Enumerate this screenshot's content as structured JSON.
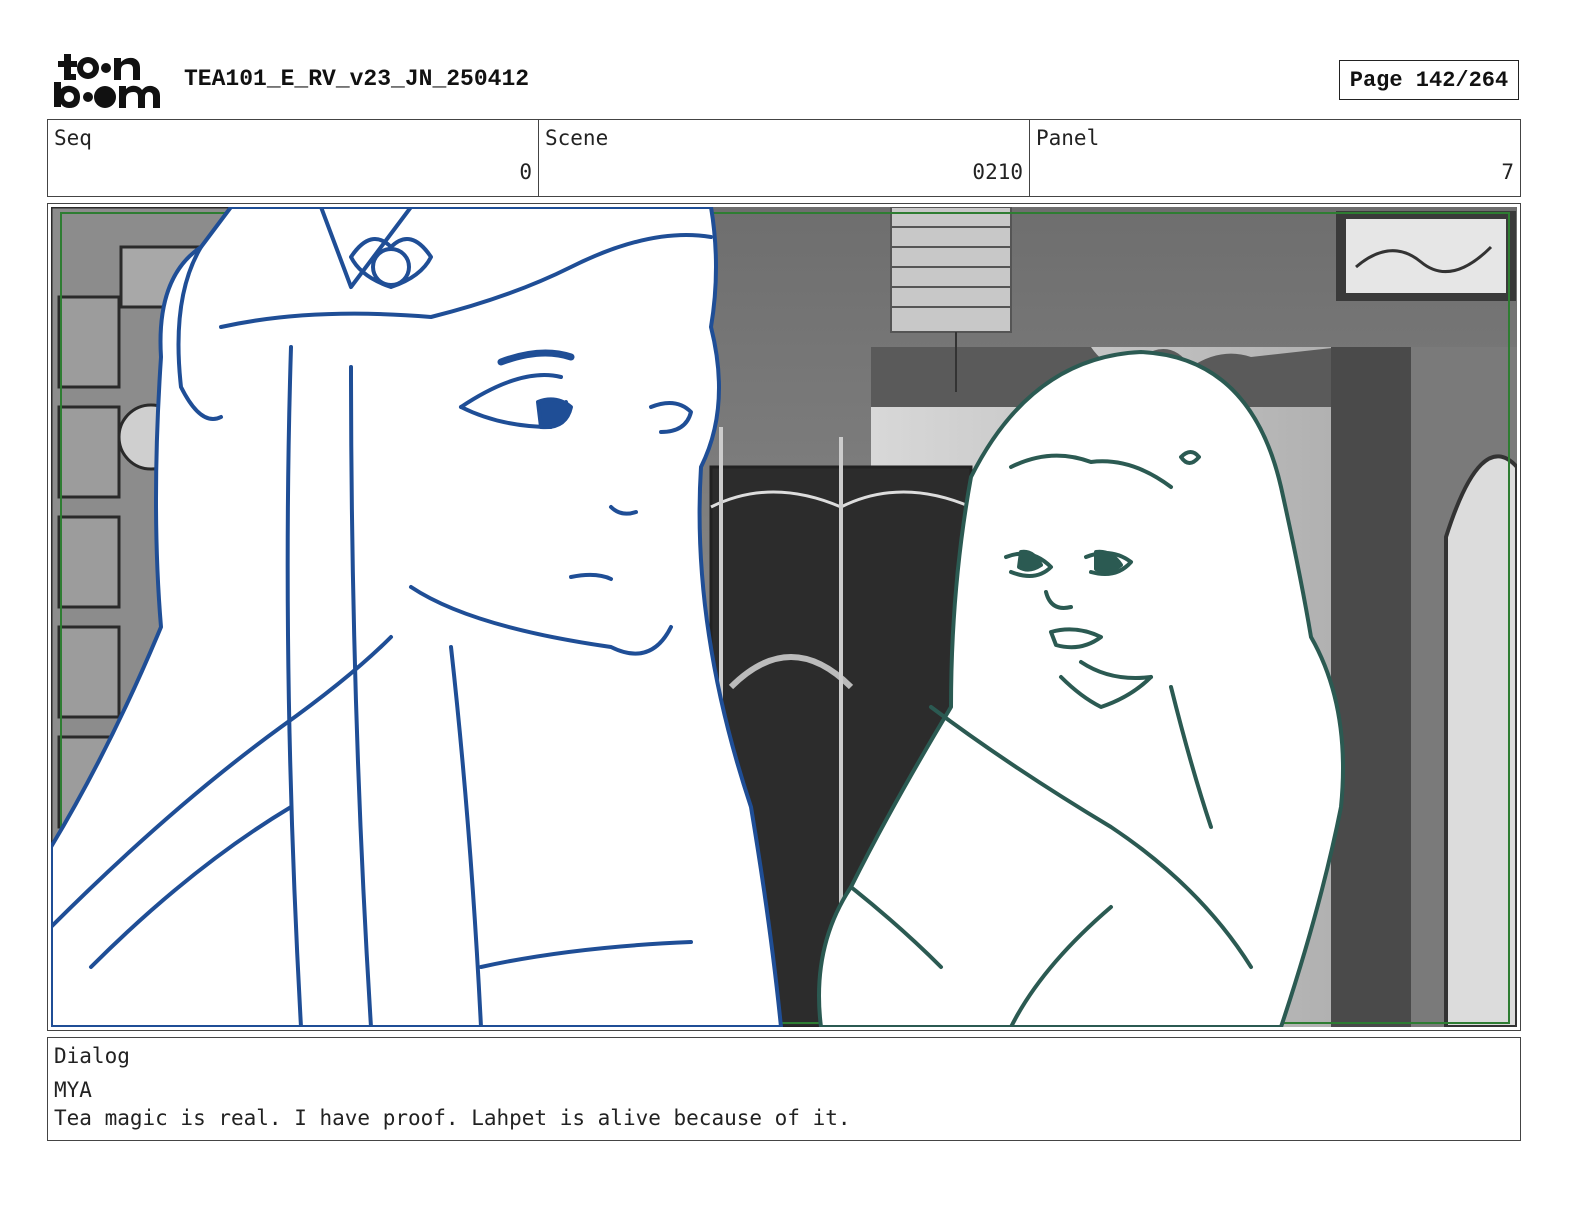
{
  "header": {
    "logo_text": "toon boom",
    "doc_title": "TEA101_E_RV_v23_JN_250412",
    "page_label": "Page 142/264"
  },
  "info": {
    "seq_label": "Seq",
    "seq_value": "0",
    "scene_label": "Scene",
    "scene_value": "0210",
    "panel_label": "Panel",
    "panel_value": "7"
  },
  "dialog": {
    "label": "Dialog",
    "speaker": "MYA",
    "line": "Tea magic is real. I have proof. Lahpet is alive because of it."
  },
  "colors": {
    "left_character_line": "#1f4e96",
    "right_character_line": "#2b5a52",
    "safe_frame": "#2e7d32",
    "background_gray": "#8a8a8a"
  },
  "icons": [
    "toon-boom-logo"
  ]
}
